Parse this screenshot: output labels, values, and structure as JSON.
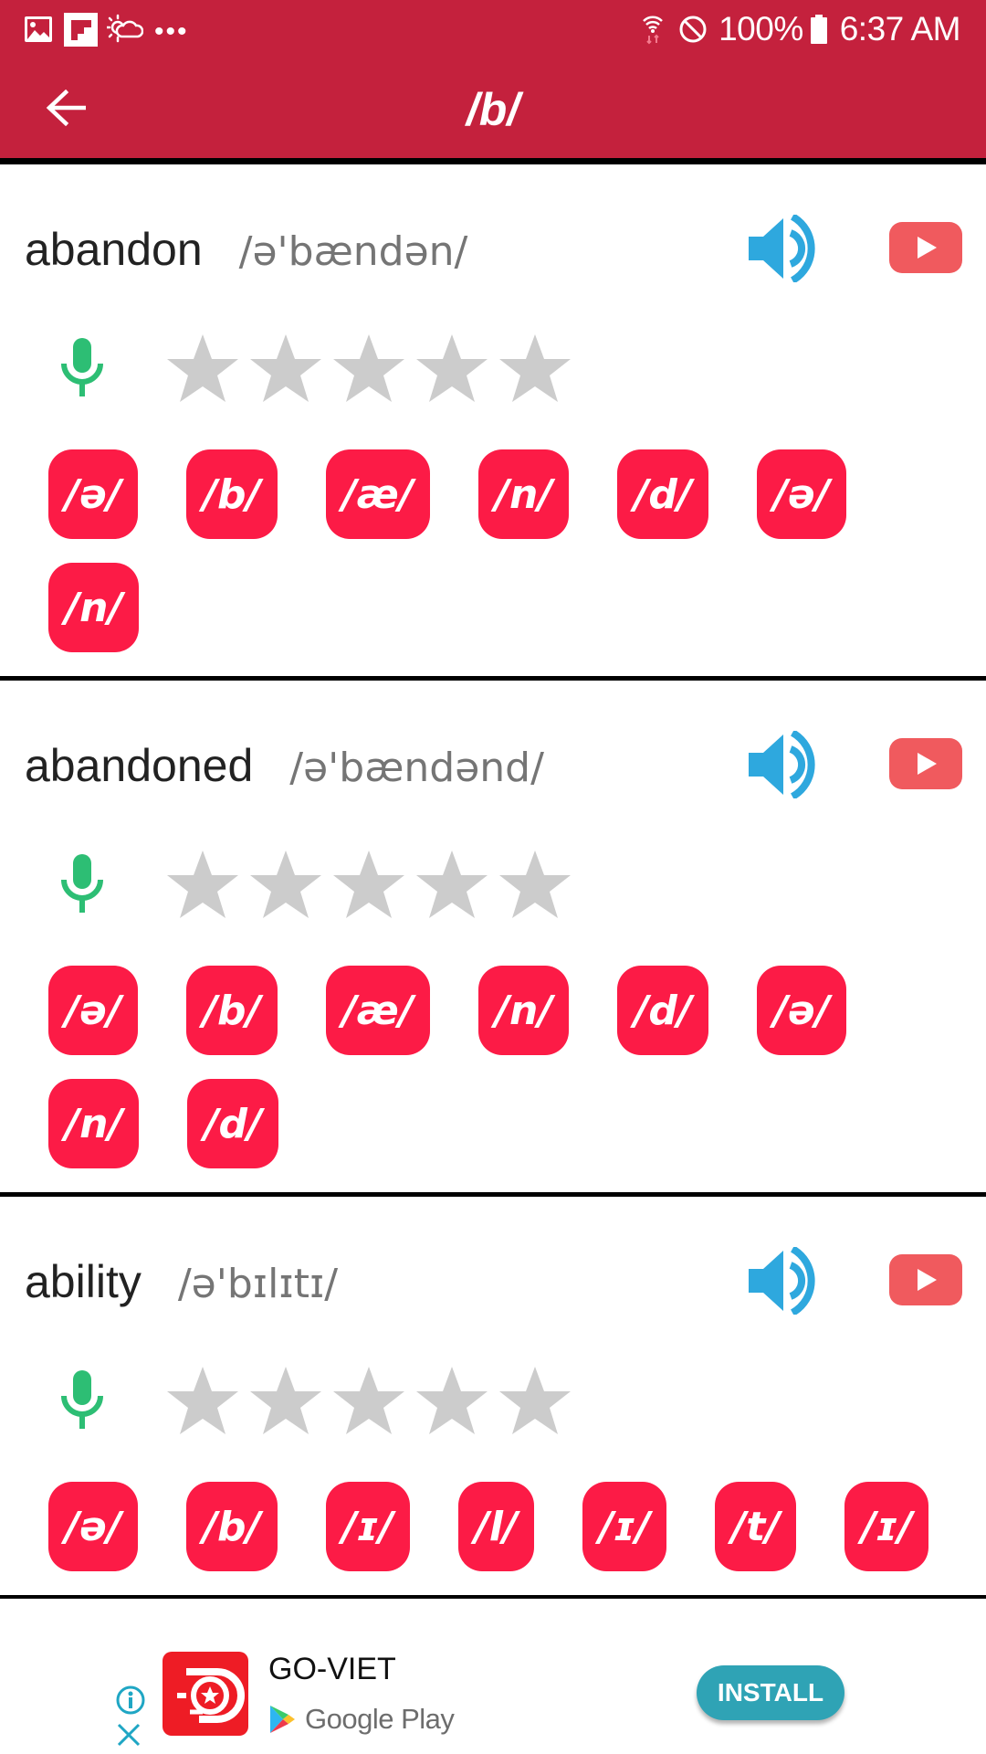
{
  "status_bar": {
    "left_icons": [
      "gallery-icon",
      "flipboard-icon",
      "weather-icon",
      "more-notifications-icon"
    ],
    "right_icons": [
      "wifi-icon",
      "do-not-disturb-icon",
      "battery-icon"
    ],
    "battery": "100%",
    "time": "6:37 AM"
  },
  "app_bar": {
    "back_icon": "arrow-left-icon",
    "title": "/b/"
  },
  "colors": {
    "header": "#C4213D",
    "phoneme_button": "#FC1B46",
    "speaker": "#2EA8DE",
    "youtube": "#F05A5E",
    "mic": "#2DBE74",
    "star_empty": "#CCCCCC",
    "install_button": "#2FA3B5"
  },
  "cards": [
    {
      "word": "abandon",
      "pronunciation": "/ə'bændən/",
      "rating": 0,
      "rating_max": 5,
      "phoneme_rows": [
        [
          "/ə/",
          "/b/",
          "/æ/",
          "/n/",
          "/d/",
          "/ə/"
        ],
        [
          "/n/"
        ]
      ]
    },
    {
      "word": "abandoned",
      "pronunciation": "/ə'bændənd/",
      "rating": 0,
      "rating_max": 5,
      "phoneme_rows": [
        [
          "/ə/",
          "/b/",
          "/æ/",
          "/n/",
          "/d/",
          "/ə/"
        ],
        [
          "/n/",
          "/d/"
        ]
      ]
    },
    {
      "word": "ability",
      "pronunciation": "/ə'bɪlɪtɪ/",
      "rating": 0,
      "rating_max": 5,
      "phoneme_rows": [
        [
          "/ə/",
          "/b/",
          "/ɪ/",
          "/l/",
          "/ɪ/",
          "/t/",
          "/ɪ/"
        ]
      ]
    }
  ],
  "ad": {
    "info_icon": "info-icon",
    "close_icon": "close-icon",
    "app_name": "GO-VIET",
    "store": "Google Play",
    "install_label": "INSTALL"
  }
}
